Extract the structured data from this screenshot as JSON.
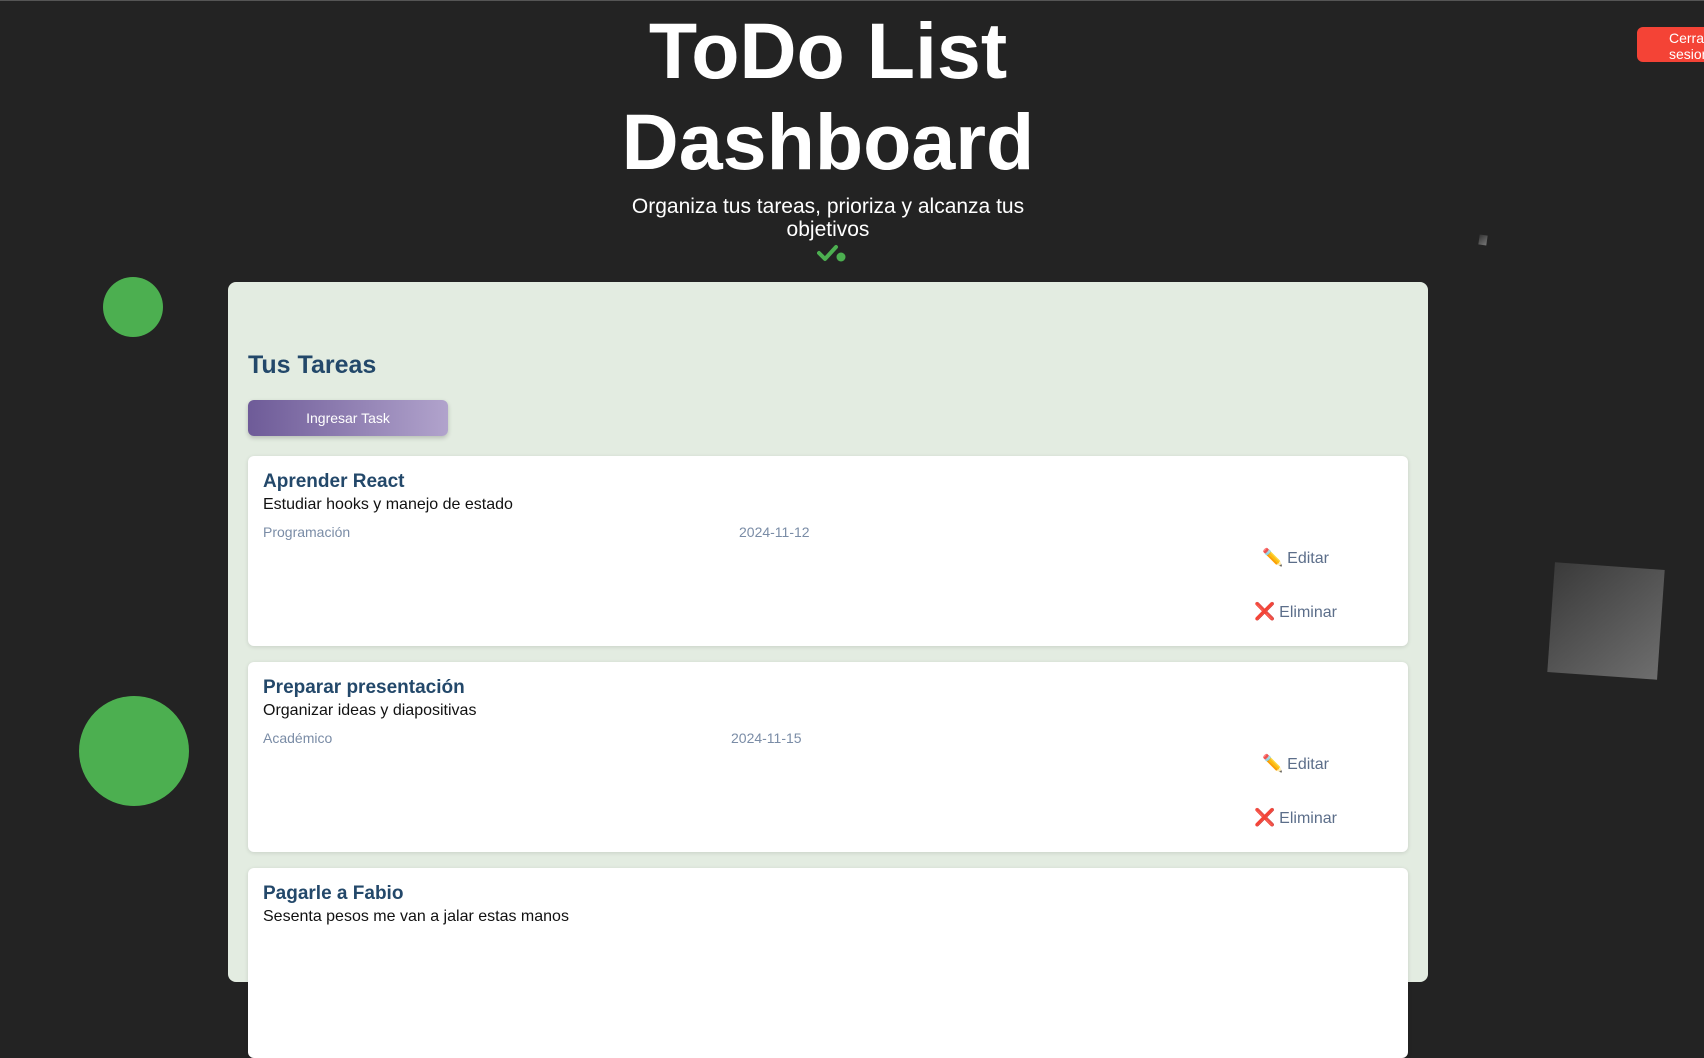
{
  "header": {
    "title_line1": "ToDo List",
    "title_line2": "Dashboard",
    "subtitle_line1": "Organiza tus tareas, prioriza y alcanza tus",
    "subtitle_line2": "objetivos",
    "subtitle_icon": "check-dot-icon"
  },
  "logout": {
    "label": "Cerrar sesion"
  },
  "tasks_section": {
    "title": "Tus Tareas",
    "add_button_label": "Ingresar Task"
  },
  "tasks": [
    {
      "title": "Aprender React",
      "description": "Estudiar hooks y manejo de estado",
      "category": "Programación",
      "date": "2024-11-12",
      "edit_label": "Editar",
      "delete_label": "Eliminar"
    },
    {
      "title": "Preparar presentación",
      "description": "Organizar ideas y diapositivas",
      "category": "Académico",
      "date": "2024-11-15",
      "edit_label": "Editar",
      "delete_label": "Eliminar"
    },
    {
      "title": "Pagarle a Fabio",
      "description": "Sesenta pesos me van a jalar estas manos"
    }
  ],
  "colors": {
    "background": "#232323",
    "panel": "#e3ece1",
    "accent_green": "#4caf50",
    "logout_red": "#f44336",
    "heading_blue": "#23486a"
  },
  "icons": {
    "edit": "pencil-icon",
    "delete": "cross-mark-icon"
  }
}
